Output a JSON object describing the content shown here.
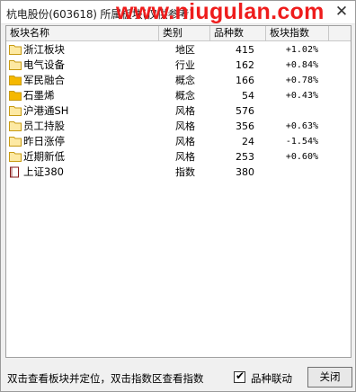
{
  "window": {
    "title": "杭电股份(603618) 所属板块(仅供参考)",
    "watermark": "www.niugulan.com",
    "close_glyph": "✕"
  },
  "table": {
    "columns": [
      "板块名称",
      "类别",
      "品种数",
      "板块指数"
    ],
    "rows": [
      {
        "name": "浙江板块",
        "type": "地区",
        "count": "415",
        "index": "+1.02%",
        "icon": "folder-icon"
      },
      {
        "name": "电气设备",
        "type": "行业",
        "count": "162",
        "index": "+0.84%",
        "icon": "folder-icon"
      },
      {
        "name": "军民融合",
        "type": "概念",
        "count": "166",
        "index": "+0.78%",
        "icon": "folder-filled-icon"
      },
      {
        "name": "石墨烯",
        "type": "概念",
        "count": "54",
        "index": "+0.43%",
        "icon": "folder-filled-icon"
      },
      {
        "name": "沪港通SH",
        "type": "风格",
        "count": "576",
        "index": "",
        "icon": "folder-icon"
      },
      {
        "name": "员工持股",
        "type": "风格",
        "count": "356",
        "index": "+0.63%",
        "icon": "folder-icon"
      },
      {
        "name": "昨日涨停",
        "type": "风格",
        "count": "24",
        "index": "-1.54%",
        "icon": "folder-icon"
      },
      {
        "name": "近期新低",
        "type": "风格",
        "count": "253",
        "index": "+0.60%",
        "icon": "folder-icon"
      },
      {
        "name": "上证380",
        "type": "指数",
        "count": "380",
        "index": "",
        "icon": "index-icon"
      }
    ]
  },
  "footer": {
    "hint": "双击查看板块并定位，双击指数区查看指数",
    "checkbox_label": "品种联动",
    "checkbox_checked": true,
    "close_label": "关闭"
  },
  "colors": {
    "watermark": "#ee1c1c",
    "folder": "#f2c230",
    "folder_filled": "#f5b800"
  }
}
